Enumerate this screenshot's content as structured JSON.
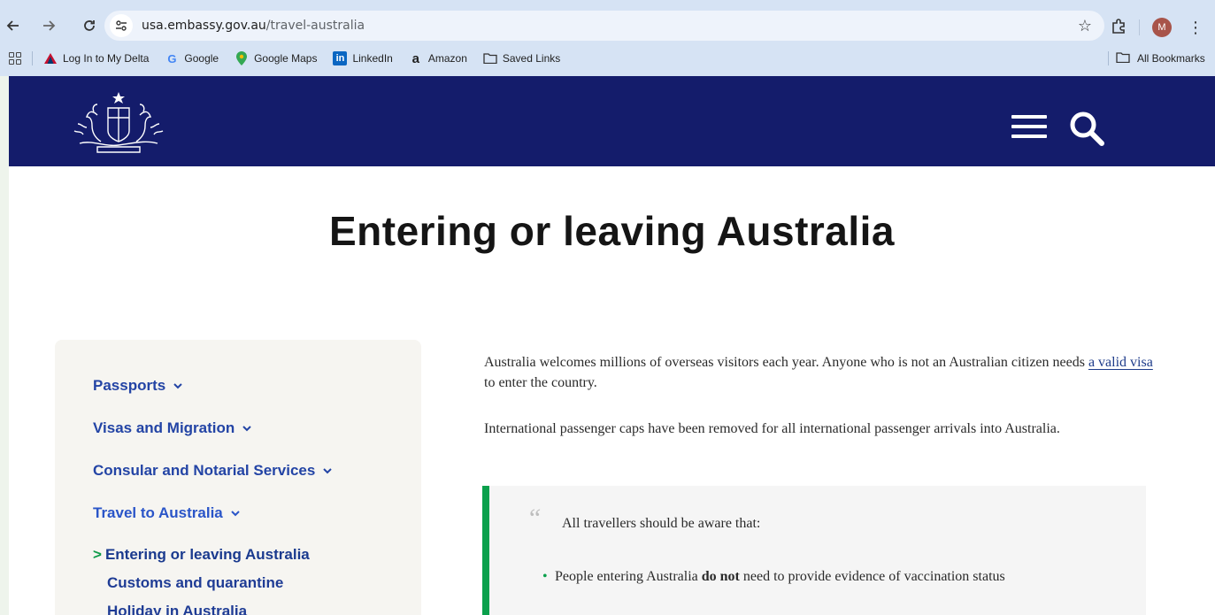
{
  "browser": {
    "url_host": "usa.embassy.gov.au",
    "url_path": "/travel-australia",
    "avatar_letter": "M",
    "bookmarks": [
      {
        "label": "Log In to My Delta",
        "icon": "delta-icon"
      },
      {
        "label": "Google",
        "icon": "google-icon"
      },
      {
        "label": "Google Maps",
        "icon": "maps-icon"
      },
      {
        "label": "LinkedIn",
        "icon": "linkedin-icon"
      },
      {
        "label": "Amazon",
        "icon": "amazon-icon"
      },
      {
        "label": "Saved Links",
        "icon": "folder-icon"
      }
    ],
    "all_bookmarks": "All Bookmarks"
  },
  "page": {
    "title": "Entering or leaving Australia",
    "sidenav": {
      "items": [
        {
          "label": "Passports"
        },
        {
          "label": "Visas and Migration"
        },
        {
          "label": "Consular and Notarial Services"
        },
        {
          "label": "Travel to Australia"
        }
      ],
      "sub_items": [
        {
          "label": "Entering or leaving Australia"
        },
        {
          "label": "Customs and quarantine"
        },
        {
          "label": "Holiday in Australia"
        }
      ]
    },
    "content": {
      "para1_before": "Australia welcomes millions of overseas visitors each year. Anyone who is not an Australian citizen needs ",
      "para1_link": "a valid visa",
      "para1_after": " to enter the country.",
      "para2": "International passenger caps have been removed for all international passenger arrivals into Australia.",
      "callout_intro": "All travellers should be aware that:",
      "bullet_before": "People entering Australia ",
      "bullet_bold": "do not",
      "bullet_after": " need to provide evidence of vaccination status"
    }
  },
  "colors": {
    "header": "#141c6b",
    "nav_link": "#2344a5",
    "accent_green": "#0aa04c"
  }
}
